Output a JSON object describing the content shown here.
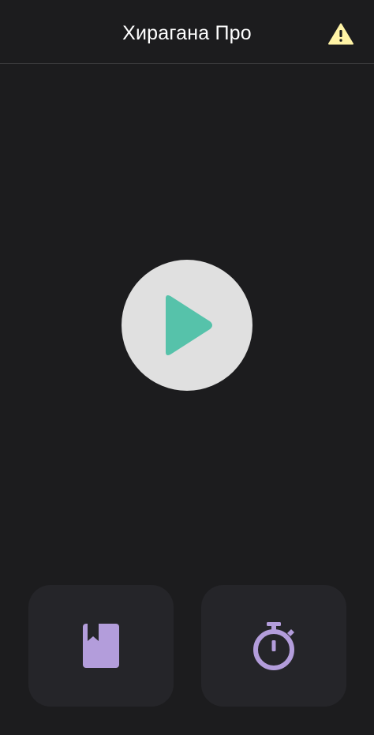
{
  "app_bar": {
    "title": "Хирагана Про",
    "action_icon": "warning-icon",
    "warning_color": "#fff3a6"
  },
  "main": {
    "play_icon": "play-icon",
    "play_bg_color": "#e0e0e0",
    "play_icon_color": "#56c2aa"
  },
  "bottom_tiles": [
    {
      "icon": "bookmark-book-icon",
      "color": "#b39ddb"
    },
    {
      "icon": "stopwatch-icon",
      "color": "#b39ddb"
    }
  ]
}
